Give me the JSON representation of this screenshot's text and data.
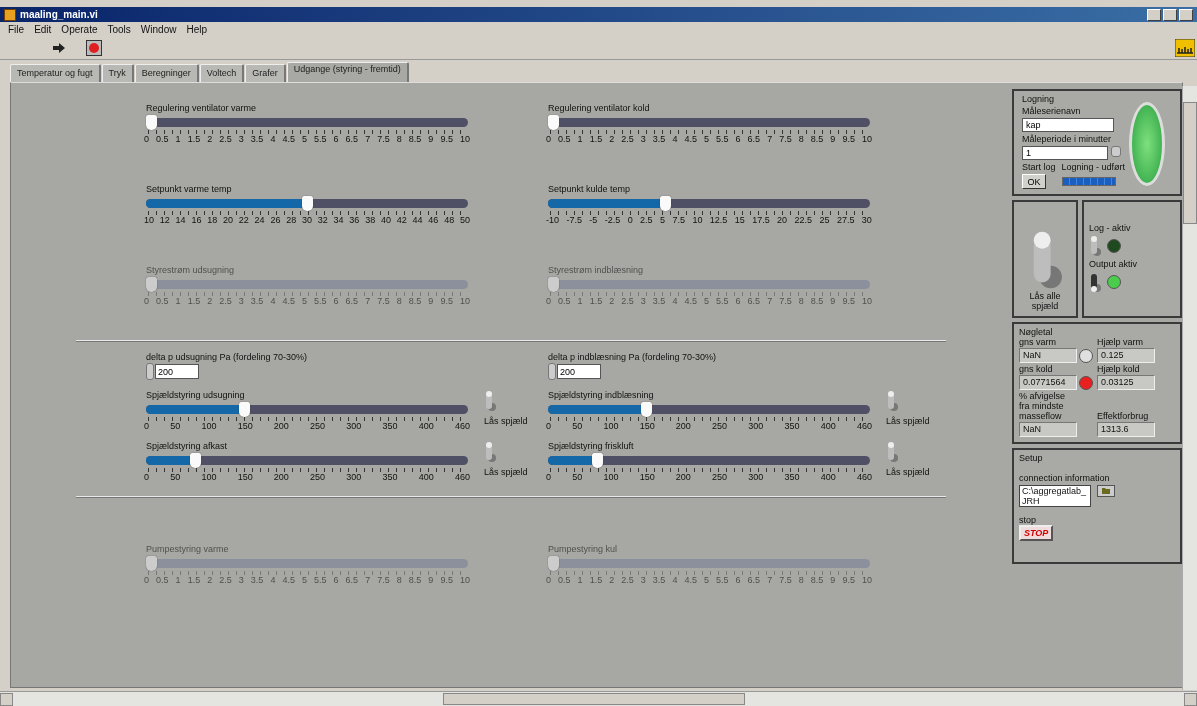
{
  "window": {
    "title": "maaling_main.vi"
  },
  "menu": [
    "File",
    "Edit",
    "Operate",
    "Tools",
    "Window",
    "Help"
  ],
  "tabs": [
    {
      "label": "Temperatur og fugt",
      "selected": false
    },
    {
      "label": "Tryk",
      "selected": false
    },
    {
      "label": "Beregninger",
      "selected": false
    },
    {
      "label": "Voltech",
      "selected": false
    },
    {
      "label": "Grafer",
      "selected": false
    },
    {
      "label": "Udgange (styring - fremtid)",
      "selected": true
    }
  ],
  "upper_sliders": [
    {
      "label": "Regulering ventilator varme",
      "level": 0,
      "disabled": false,
      "ticks": [
        "0",
        "0.5",
        "1",
        "1.5",
        "2",
        "2.5",
        "3",
        "3.5",
        "4",
        "4.5",
        "5",
        "5.5",
        "6",
        "6.5",
        "7",
        "7.5",
        "8",
        "8.5",
        "9",
        "9.5",
        "10"
      ]
    },
    {
      "label": "Regulering ventilator kold",
      "level": 0,
      "disabled": false,
      "ticks": [
        "0",
        "0.5",
        "1",
        "1.5",
        "2",
        "2.5",
        "3",
        "3.5",
        "4",
        "4.5",
        "5",
        "5.5",
        "6",
        "6.5",
        "7",
        "7.5",
        "8",
        "8.5",
        "9",
        "9.5",
        "10"
      ]
    },
    {
      "label": "Setpunkt varme temp",
      "level": 0.5,
      "disabled": false,
      "ticks": [
        "10",
        "12",
        "14",
        "16",
        "18",
        "20",
        "22",
        "24",
        "26",
        "28",
        "30",
        "32",
        "34",
        "36",
        "38",
        "40",
        "42",
        "44",
        "46",
        "48",
        "50"
      ]
    },
    {
      "label": "Setpunkt kulde temp",
      "level": 0.36,
      "disabled": false,
      "ticks": [
        "-10",
        "-7.5",
        "-5",
        "-2.5",
        "0",
        "2.5",
        "5",
        "7.5",
        "10",
        "12.5",
        "15",
        "17.5",
        "20",
        "22.5",
        "25",
        "27.5",
        "30"
      ]
    },
    {
      "label": "Styrestrøm udsugning",
      "level": 0,
      "disabled": true,
      "ticks": [
        "0",
        "0.5",
        "1",
        "1.5",
        "2",
        "2.5",
        "3",
        "3.5",
        "4",
        "4.5",
        "5",
        "5.5",
        "6",
        "6.5",
        "7",
        "7.5",
        "8",
        "8.5",
        "9",
        "9.5",
        "10"
      ]
    },
    {
      "label": "Styrestrøm indblæsning",
      "level": 0,
      "disabled": true,
      "ticks": [
        "0",
        "0.5",
        "1",
        "1.5",
        "2",
        "2.5",
        "3",
        "3.5",
        "4",
        "4.5",
        "5",
        "5.5",
        "6",
        "6.5",
        "7",
        "7.5",
        "8",
        "8.5",
        "9",
        "9.5",
        "10"
      ]
    }
  ],
  "pressure_fields": [
    {
      "label": "delta p udsugning Pa (fordeling 70-30%)",
      "value": "200"
    },
    {
      "label": "delta p indblæsning Pa (fordeling 70-30%)",
      "value": "200"
    }
  ],
  "damper_sliders": [
    {
      "label": "Spjældstyring udsugning",
      "level": 0.3,
      "disabled": false,
      "locked": false,
      "lock_label": "Lås spjæld",
      "ticks": [
        "0",
        "50",
        "100",
        "150",
        "200",
        "250",
        "300",
        "350",
        "400",
        "460"
      ]
    },
    {
      "label": "Spjældstyring indblæsning",
      "level": 0.3,
      "disabled": false,
      "locked": false,
      "lock_label": "Lås spjæld",
      "ticks": [
        "0",
        "50",
        "100",
        "150",
        "200",
        "250",
        "300",
        "350",
        "400",
        "460"
      ]
    },
    {
      "label": "Spjældstyring afkast",
      "level": 0.14,
      "disabled": false,
      "locked": false,
      "lock_label": "Lås spjæld",
      "ticks": [
        "0",
        "50",
        "100",
        "150",
        "200",
        "250",
        "300",
        "350",
        "400",
        "460"
      ]
    },
    {
      "label": "Spjældstyring friskluft",
      "level": 0.14,
      "disabled": false,
      "locked": false,
      "lock_label": "Lås spjæld",
      "ticks": [
        "0",
        "50",
        "100",
        "150",
        "200",
        "250",
        "300",
        "350",
        "400",
        "460"
      ]
    }
  ],
  "pump_sliders": [
    {
      "label": "Pumpestyring varme",
      "level": 0,
      "disabled": true,
      "ticks": [
        "0",
        "0.5",
        "1",
        "1.5",
        "2",
        "2.5",
        "3",
        "3.5",
        "4",
        "4.5",
        "5",
        "5.5",
        "6",
        "6.5",
        "7",
        "7.5",
        "8",
        "8.5",
        "9",
        "9.5",
        "10"
      ]
    },
    {
      "label": "Pumpestyring kul",
      "level": 0,
      "disabled": true,
      "ticks": [
        "0",
        "0.5",
        "1",
        "1.5",
        "2",
        "2.5",
        "3",
        "3.5",
        "4",
        "4.5",
        "5",
        "5.5",
        "6",
        "6.5",
        "7",
        "7.5",
        "8",
        "8.5",
        "9",
        "9.5",
        "10"
      ]
    }
  ],
  "logging": {
    "title": "Logning",
    "series_label": "Måleserienavn",
    "series_value": "kap",
    "period_label": "Måleperiode i minutter",
    "period_value": "1",
    "start_label": "Start log",
    "ok_button": "OK",
    "progress_label": "Logning - udført",
    "progress": {
      "level": 1
    },
    "lamp_on": true
  },
  "lock_all": {
    "label": "Lås alle spjæld",
    "switch_on": false
  },
  "activity": [
    {
      "label": "Log - aktiv",
      "switch_on": false,
      "on": false
    },
    {
      "label": "Output aktiv",
      "switch_on": true,
      "on": true
    }
  ],
  "key_figures": {
    "title": "Nøgletal",
    "rows": [
      {
        "left_label": "gns varm",
        "left_value": "NaN",
        "lamp": {
          "on": false
        },
        "right_label": "Hjælp varm",
        "right_value": "0.125"
      },
      {
        "left_label": "gns kold",
        "left_value": "0.0771564",
        "lamp": {
          "on": true
        },
        "right_label": "Hjælp kold",
        "right_value": "0.03125"
      },
      {
        "left_label": "% afvigelse fra mindste masseflow",
        "left_value": "NaN",
        "right_label": "Effektforbrug",
        "right_value": "1313.6"
      }
    ]
  },
  "setup": {
    "title": "Setup",
    "connection_label": "connection information",
    "connection_value": "C:\\aggregatlab_JRH",
    "stop_label": "stop",
    "stop_button": "STOP"
  }
}
